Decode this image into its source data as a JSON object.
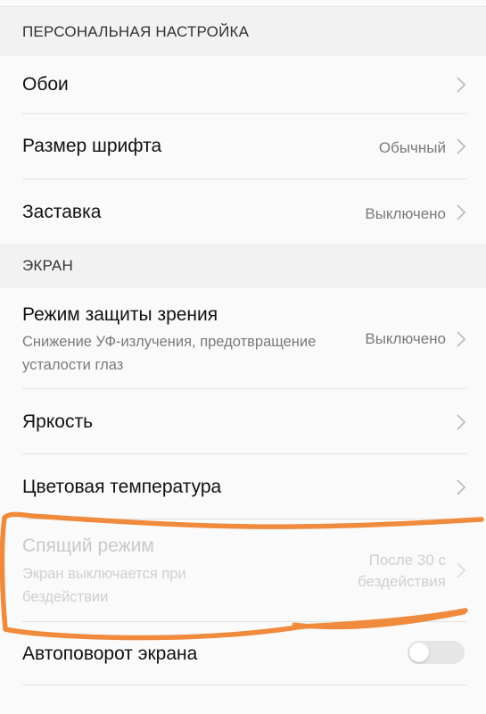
{
  "colors": {
    "section_background": "#f2f2f2",
    "list_background": "#fafafa",
    "secondary_text": "#7a7a7a",
    "disabled_text": "#c9c9c9",
    "annotation_stroke": "#f08a3c"
  },
  "sections": {
    "personal": {
      "header": "ПЕРСОНАЛЬНАЯ НАСТРОЙКА",
      "items": {
        "wallpaper": {
          "title": "Обои",
          "icon": "chevron-right-icon"
        },
        "font_size": {
          "title": "Размер шрифта",
          "value": "Обычный",
          "icon": "chevron-right-icon"
        },
        "screensaver": {
          "title": "Заставка",
          "value": "Выключено",
          "icon": "chevron-right-icon"
        }
      }
    },
    "screen": {
      "header": "ЭКРАН",
      "items": {
        "eye_comfort": {
          "title": "Режим защиты зрения",
          "subtitle": "Снижение УФ-излучения, предотвращение усталости глаз",
          "value": "Выключено",
          "icon": "chevron-right-icon"
        },
        "brightness": {
          "title": "Яркость",
          "icon": "chevron-right-icon"
        },
        "color_temperature": {
          "title": "Цветовая температура",
          "icon": "chevron-right-icon"
        },
        "sleep": {
          "title": "Спящий режим",
          "subtitle": "Экран выключается при бездействии",
          "value": "После 30 с бездействия",
          "icon": "chevron-right-icon",
          "enabled": false
        },
        "auto_rotate": {
          "title": "Автоповорот экрана",
          "toggle_on": false
        }
      }
    }
  },
  "annotation": {
    "type": "hand-drawn-highlight",
    "color": "#f08a3c"
  }
}
